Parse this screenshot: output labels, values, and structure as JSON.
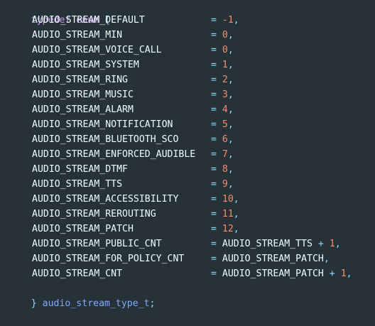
{
  "code": {
    "header": {
      "kw1": "typedef",
      "kw2": "enum",
      "brace": "{"
    },
    "entries": [
      {
        "name": "AUDIO_STREAM_DEFAULT",
        "value": "-1"
      },
      {
        "name": "AUDIO_STREAM_MIN",
        "value": "0"
      },
      {
        "name": "AUDIO_STREAM_VOICE_CALL",
        "value": "0"
      },
      {
        "name": "AUDIO_STREAM_SYSTEM",
        "value": "1"
      },
      {
        "name": "AUDIO_STREAM_RING",
        "value": "2"
      },
      {
        "name": "AUDIO_STREAM_MUSIC",
        "value": "3"
      },
      {
        "name": "AUDIO_STREAM_ALARM",
        "value": "4"
      },
      {
        "name": "AUDIO_STREAM_NOTIFICATION",
        "value": "5"
      },
      {
        "name": "AUDIO_STREAM_BLUETOOTH_SCO",
        "value": "6"
      },
      {
        "name": "AUDIO_STREAM_ENFORCED_AUDIBLE",
        "value": "7"
      },
      {
        "name": "AUDIO_STREAM_DTMF",
        "value": "8"
      },
      {
        "name": "AUDIO_STREAM_TTS",
        "value": "9"
      },
      {
        "name": "AUDIO_STREAM_ACCESSIBILITY",
        "value": "10"
      },
      {
        "name": "AUDIO_STREAM_REROUTING",
        "value": "11"
      },
      {
        "name": "AUDIO_STREAM_PATCH",
        "value": "12"
      }
    ],
    "derived": [
      {
        "name": "AUDIO_STREAM_PUBLIC_CNT",
        "ref": "AUDIO_STREAM_TTS",
        "plus": "+",
        "num": "1"
      },
      {
        "name": "AUDIO_STREAM_FOR_POLICY_CNT",
        "ref": "AUDIO_STREAM_PATCH",
        "plus": "",
        "num": ""
      },
      {
        "name": "AUDIO_STREAM_CNT",
        "ref": "AUDIO_STREAM_PATCH",
        "plus": "+",
        "num": "1"
      }
    ],
    "footer": {
      "brace": "}",
      "type_name": "audio_stream_type_t",
      "semicolon": ";"
    },
    "symbols": {
      "equals": "=",
      "comma": ","
    },
    "colors": {
      "background": "#263238",
      "keyword": "#C792EA",
      "operator": "#89DDFF",
      "number": "#F78C6C",
      "identifier": "#EEFFFF",
      "type": "#82AAFF"
    }
  }
}
